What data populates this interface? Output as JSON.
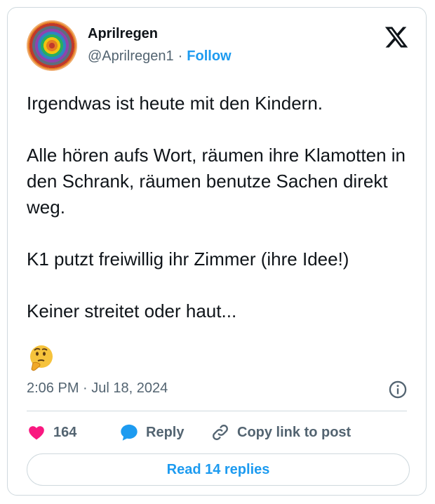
{
  "tweet": {
    "author": {
      "name": "Aprilregen",
      "handle": "@Aprilregen1",
      "separator": "·",
      "follow_label": "Follow"
    },
    "paragraphs": [
      "Irgendwas ist heute mit den Kindern.",
      "Alle hören aufs Wort, räumen ihre Klamotten in den Schrank, räumen benutze Sachen direkt weg.",
      "K1 putzt freiwillig ihr Zimmer (ihre Idee!)",
      "Keiner streitet oder haut..."
    ],
    "emoji": "thinking-face",
    "timestamp": "2:06 PM · Jul 18, 2024",
    "actions": {
      "like_count": "164",
      "reply_label": "Reply",
      "copy_label": "Copy link to post"
    },
    "read_replies_label": "Read 14 replies"
  },
  "colors": {
    "accent": "#1d9bf0",
    "like": "#f91880",
    "muted": "#536471",
    "border": "#cfd9de"
  }
}
